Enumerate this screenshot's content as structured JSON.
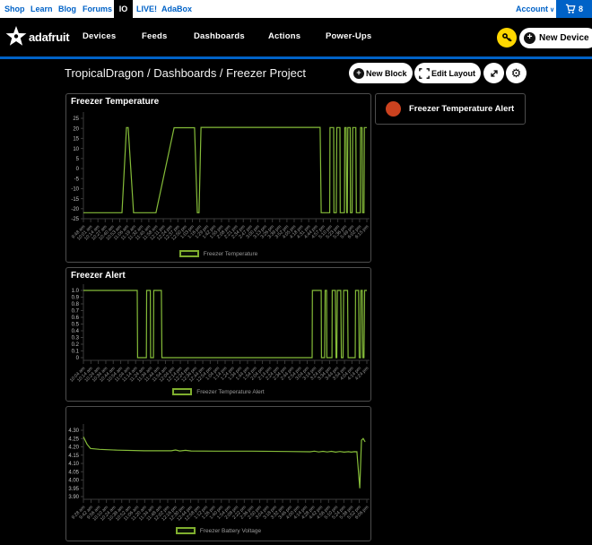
{
  "topbar": {
    "links": [
      "Shop",
      "Learn",
      "Blog",
      "Forums"
    ],
    "io_label": "IO",
    "links2": [
      "LIVE!",
      "AdaBox"
    ],
    "account_label": "Account",
    "cart_count": "8"
  },
  "nav": {
    "brand": "adafruit",
    "items": [
      "Devices",
      "Feeds",
      "Dashboards",
      "Actions",
      "Power-Ups"
    ],
    "new_device_label": "New Device"
  },
  "breadcrumb": "TropicalDragon / Dashboards / Freezer Project",
  "toolbar": {
    "new_block_label": "New Block",
    "edit_layout_label": "Edit Layout"
  },
  "alert_block": {
    "label": "Freezer Temperature Alert",
    "indicator_color": "#cb421f"
  },
  "colors": {
    "accent_blue": "#0062c7",
    "chart_green": "#8cc63c",
    "panel_border": "#4d4d4d",
    "key_yellow": "#ffd700",
    "alert_red": "#cb421f"
  },
  "chart_data": [
    {
      "type": "line",
      "title": "Freezer Temperature",
      "legend": "Freezer Temperature",
      "ylim": [
        -25,
        25
      ],
      "yticks": [
        "25",
        "20",
        "15",
        "10",
        "5",
        "0",
        "-5",
        "-10",
        "-15",
        "-20",
        "-25"
      ],
      "x_labels": [
        "9:48 am",
        "10:01 am",
        "10:14 am",
        "10:27 am",
        "10:40 am",
        "10:53 am",
        "11:06 am",
        "11:19 am",
        "11:32 am",
        "11:45 am",
        "11:58 am",
        "12:11 pm",
        "12:24 pm",
        "12:37 pm",
        "12:50 pm",
        "1:03 pm",
        "1:16 pm",
        "1:29 pm",
        "1:42 pm",
        "1:55 pm",
        "2:08 pm",
        "2:21 pm",
        "2:34 pm",
        "2:47 pm",
        "3:00 pm",
        "3:13 pm",
        "3:26 pm",
        "3:39 pm",
        "3:52 pm",
        "4:05 pm",
        "4:18 pm",
        "4:31 pm",
        "4:44 pm",
        "4:57 pm",
        "5:10 pm",
        "5:23 pm",
        "5:36 pm",
        "5:49 pm",
        "6:02 pm",
        "6:15 pm"
      ],
      "points": [
        [
          0,
          -22
        ],
        [
          0.136,
          -22
        ],
        [
          0.152,
          20.4
        ],
        [
          0.158,
          20.4
        ],
        [
          0.177,
          -22
        ],
        [
          0.256,
          -22
        ],
        [
          0.32,
          20.3
        ],
        [
          0.392,
          20.3
        ],
        [
          0.402,
          -22
        ],
        [
          0.408,
          -22
        ],
        [
          0.415,
          20.5
        ],
        [
          0.835,
          20.5
        ],
        [
          0.839,
          -22
        ],
        [
          0.869,
          -22
        ],
        [
          0.87,
          20.4
        ],
        [
          0.883,
          20.4
        ],
        [
          0.884,
          -22
        ],
        [
          0.892,
          -22
        ],
        [
          0.894,
          20.4
        ],
        [
          0.905,
          20.4
        ],
        [
          0.906,
          -22
        ],
        [
          0.921,
          -22
        ],
        [
          0.922,
          20.4
        ],
        [
          0.927,
          20.4
        ],
        [
          0.929,
          -22
        ],
        [
          0.931,
          -22
        ],
        [
          0.933,
          20.4
        ],
        [
          0.941,
          20.4
        ],
        [
          0.942,
          -22
        ],
        [
          0.948,
          -22
        ],
        [
          0.95,
          20.4
        ],
        [
          0.961,
          20.4
        ],
        [
          0.963,
          -22
        ],
        [
          0.977,
          -22
        ],
        [
          0.978,
          20.4
        ],
        [
          0.983,
          20.4
        ],
        [
          0.985,
          -22
        ],
        [
          0.99,
          -22
        ],
        [
          0.991,
          20.4
        ],
        [
          1,
          20.4
        ]
      ]
    },
    {
      "type": "line",
      "title": "Freezer Alert",
      "legend": "Freezer Temperature Alert",
      "ylim": [
        0,
        1
      ],
      "yticks": [
        "1.0",
        "0.9",
        "0.8",
        "0.7",
        "0.6",
        "0.5",
        "0.4",
        "0.3",
        "0.2",
        "0.1",
        "0"
      ],
      "x_labels": [
        "10:04 am",
        "10:14 am",
        "10:24 am",
        "10:34 am",
        "10:44 am",
        "10:54 am",
        "11:04 am",
        "11:14 am",
        "11:24 am",
        "11:34 am",
        "11:44 am",
        "11:54 am",
        "12:04 pm",
        "12:14 pm",
        "12:24 pm",
        "12:34 pm",
        "12:44 pm",
        "12:54 pm",
        "1:04 pm",
        "1:14 pm",
        "1:24 pm",
        "1:34 pm",
        "1:44 pm",
        "1:54 pm",
        "2:04 pm",
        "2:14 pm",
        "2:24 pm",
        "2:34 pm",
        "2:44 pm",
        "2:54 pm",
        "3:04 pm",
        "3:14 pm",
        "3:24 pm",
        "3:34 pm",
        "3:44 pm",
        "3:54 pm",
        "4:04 pm",
        "4:14 pm",
        "4:24 pm"
      ],
      "points": [
        [
          0,
          1
        ],
        [
          0.19,
          1
        ],
        [
          0.191,
          0
        ],
        [
          0.222,
          0
        ],
        [
          0.223,
          1
        ],
        [
          0.236,
          1
        ],
        [
          0.237,
          0
        ],
        [
          0.247,
          0
        ],
        [
          0.248,
          1
        ],
        [
          0.275,
          1
        ],
        [
          0.277,
          0
        ],
        [
          0.807,
          0
        ],
        [
          0.808,
          1
        ],
        [
          0.839,
          1
        ],
        [
          0.84,
          0
        ],
        [
          0.851,
          0
        ],
        [
          0.853,
          1
        ],
        [
          0.858,
          1
        ],
        [
          0.859,
          0
        ],
        [
          0.877,
          0
        ],
        [
          0.878,
          1
        ],
        [
          0.889,
          1
        ],
        [
          0.891,
          0
        ],
        [
          0.894,
          0
        ],
        [
          0.896,
          1
        ],
        [
          0.908,
          1
        ],
        [
          0.91,
          0
        ],
        [
          0.916,
          0
        ],
        [
          0.918,
          1
        ],
        [
          0.932,
          1
        ],
        [
          0.934,
          0
        ],
        [
          0.959,
          0
        ],
        [
          0.96,
          1
        ],
        [
          0.971,
          1
        ],
        [
          0.973,
          0
        ],
        [
          0.978,
          0
        ],
        [
          0.979,
          1
        ],
        [
          0.984,
          1
        ],
        [
          0.986,
          0
        ],
        [
          0.99,
          0
        ],
        [
          0.992,
          1
        ],
        [
          1,
          1
        ]
      ]
    },
    {
      "type": "line",
      "title": "",
      "legend": "Freezer Battery Voltage",
      "ylim": [
        3.9,
        4.3
      ],
      "yticks": [
        "4.30",
        "4.25",
        "4.20",
        "4.15",
        "4.10",
        "4.05",
        "4.00",
        "3.95",
        "3.90"
      ],
      "x_labels": [
        "9:28 am",
        "9:42 am",
        "9:56 am",
        "10:10 am",
        "10:24 am",
        "10:38 am",
        "10:52 am",
        "11:06 am",
        "11:20 am",
        "11:34 am",
        "11:48 am",
        "12:02 pm",
        "12:16 pm",
        "12:30 pm",
        "12:44 pm",
        "12:58 pm",
        "1:12 pm",
        "1:26 pm",
        "1:40 pm",
        "1:54 pm",
        "2:08 pm",
        "2:22 pm",
        "2:36 pm",
        "2:50 pm",
        "3:04 pm",
        "3:18 pm",
        "3:32 pm",
        "3:46 pm",
        "4:00 pm",
        "4:14 pm",
        "4:28 pm",
        "4:42 pm",
        "4:56 pm",
        "5:10 pm",
        "5:24 pm",
        "5:38 pm",
        "5:52 pm",
        "6:06 pm"
      ],
      "points": [
        [
          0,
          4.26
        ],
        [
          0.013,
          4.215
        ],
        [
          0.025,
          4.19
        ],
        [
          0.057,
          4.185
        ],
        [
          0.12,
          4.18
        ],
        [
          0.215,
          4.176
        ],
        [
          0.31,
          4.176
        ],
        [
          0.325,
          4.181
        ],
        [
          0.34,
          4.175
        ],
        [
          0.36,
          4.179
        ],
        [
          0.38,
          4.175
        ],
        [
          0.468,
          4.174
        ],
        [
          0.595,
          4.174
        ],
        [
          0.722,
          4.172
        ],
        [
          0.8,
          4.17
        ],
        [
          0.815,
          4.174
        ],
        [
          0.83,
          4.169
        ],
        [
          0.845,
          4.173
        ],
        [
          0.86,
          4.169
        ],
        [
          0.875,
          4.173
        ],
        [
          0.89,
          4.168
        ],
        [
          0.905,
          4.172
        ],
        [
          0.92,
          4.168
        ],
        [
          0.935,
          4.171
        ],
        [
          0.945,
          4.168
        ],
        [
          0.956,
          4.171
        ],
        [
          0.965,
          4.17
        ],
        [
          0.975,
          3.95
        ],
        [
          0.981,
          4.24
        ],
        [
          0.987,
          4.25
        ],
        [
          0.994,
          4.23
        ]
      ]
    }
  ]
}
